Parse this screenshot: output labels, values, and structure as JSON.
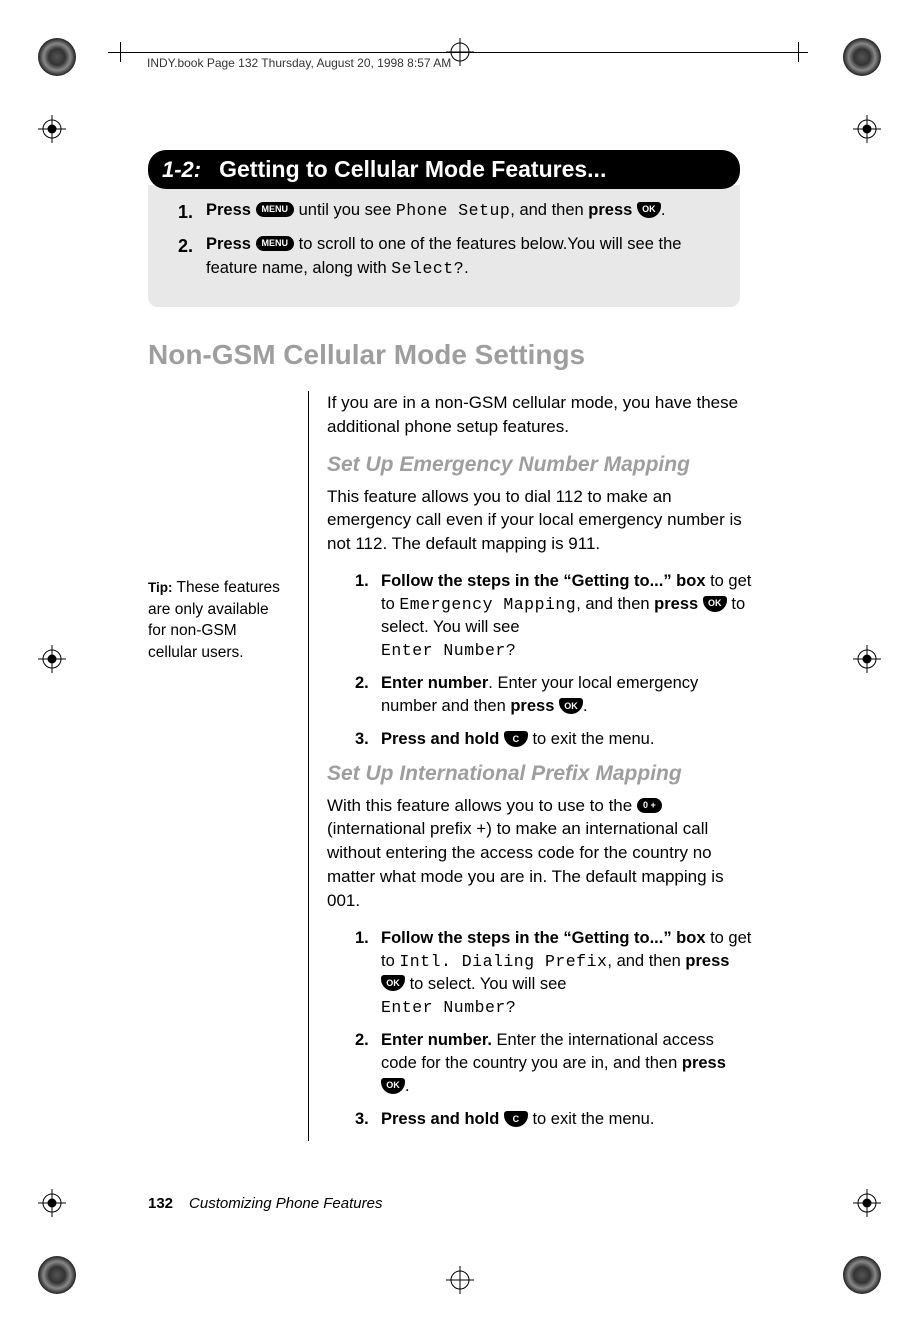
{
  "header_runner": "INDY.book  Page 132  Thursday, August 20, 1998  8:57 AM",
  "banner": {
    "num": "1-2:",
    "title": "Getting to Cellular Mode Features..."
  },
  "banner_steps": [
    {
      "n": "1.",
      "pre": "Press ",
      "btn1": "MENU",
      "mid": "  until you see ",
      "lcd": "Phone Setup",
      "mid2": ", and then ",
      "bold2": "press ",
      "btn2": "OK",
      "post": "."
    },
    {
      "n": "2.",
      "pre": "Press ",
      "btn1": "MENU",
      "mid": "  to scroll to one of the features below.You will see the feature name, along with ",
      "lcd": "Select?",
      "post": "."
    }
  ],
  "h2": "Non-GSM Cellular Mode Settings",
  "tip": {
    "label": "Tip:",
    "text": " These features are only available for non-GSM cellular users."
  },
  "intro_para": "If you are in a non-GSM cellular mode, you have these additional phone setup features.",
  "h3a": "Set Up Emergency Number Mapping",
  "para_a": "This feature allows you to dial 112 to make an emergency call even if your local emergency number is not 112. The default mapping is 911.",
  "steps_a": [
    {
      "n": "1.",
      "bold": "Follow the steps in the “Getting to...” box",
      "t1": " to get to ",
      "lcd1": "Emergency Mapping",
      "t2": ", and then ",
      "bold2": "press ",
      "btn": "OK",
      "t3": " to select. You will see ",
      "lcd2": "Enter Number?"
    },
    {
      "n": "2.",
      "bold": "Enter number",
      "t1": ". Enter your local emergency number and then ",
      "bold2": "press ",
      "btn": "OK",
      "t3": "."
    },
    {
      "n": "3.",
      "bold": "Press and hold ",
      "btn": "C",
      "t3": " to exit the menu."
    }
  ],
  "h3b": "Set Up International Prefix Mapping",
  "para_b1": "With this feature allows you to use to the ",
  "btn_zero": "0 +",
  "para_b2": " (international prefix +) to make an international call without entering the access code for the country no matter what mode you are in. The default mapping is 001.",
  "steps_b": [
    {
      "n": "1.",
      "bold": "Follow the steps in the “Getting to...” box",
      "t1": " to get to ",
      "lcd1": "Intl. Dialing Prefix",
      "t2": ", and then ",
      "bold2": "press ",
      "btn": "OK",
      "t3": " to select. You will see ",
      "lcd2": "Enter Number?"
    },
    {
      "n": "2.",
      "bold": "Enter number.",
      "t1": " Enter the international access code for the country you are in, and then ",
      "bold2": "press ",
      "btn": "OK",
      "t3": "."
    },
    {
      "n": "3.",
      "bold": "Press and hold ",
      "btn": "C",
      "t3": " to exit the menu."
    }
  ],
  "footer": {
    "page": "132",
    "chapter": "Customizing Phone Features"
  }
}
